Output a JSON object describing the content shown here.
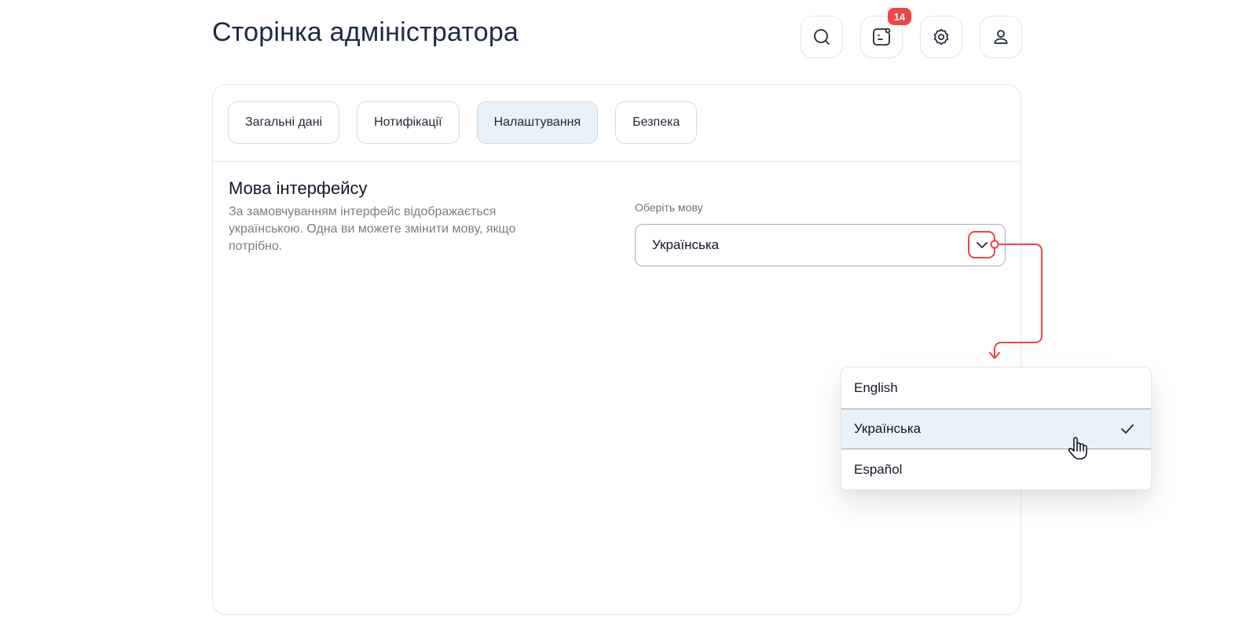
{
  "header": {
    "title": "Сторінка адміністратора",
    "icons": [
      "search-icon",
      "notes-icon",
      "gear-icon",
      "user-icon"
    ],
    "notification_badge": "14"
  },
  "tabs": [
    {
      "label": "Загальні дані",
      "active": false
    },
    {
      "label": "Нотифікації",
      "active": false
    },
    {
      "label": "Налаштування",
      "active": true
    },
    {
      "label": "Безпека",
      "active": false
    }
  ],
  "language_section": {
    "title": "Мова інтерфейсу",
    "description": "За замовчуванням інтерфейс відображається українською. Одна ви можете змінити мову, якщо потрібно.",
    "select_label": "Оберіть мову",
    "selected_value": "Українська"
  },
  "dropdown": {
    "options": [
      {
        "label": "English",
        "selected": false
      },
      {
        "label": "Українська",
        "selected": true
      },
      {
        "label": "Español",
        "selected": false
      }
    ]
  },
  "colors": {
    "accent_red": "#ef4444",
    "active_tab_bg": "#e9f2f8",
    "title_color": "#1e2a44"
  }
}
